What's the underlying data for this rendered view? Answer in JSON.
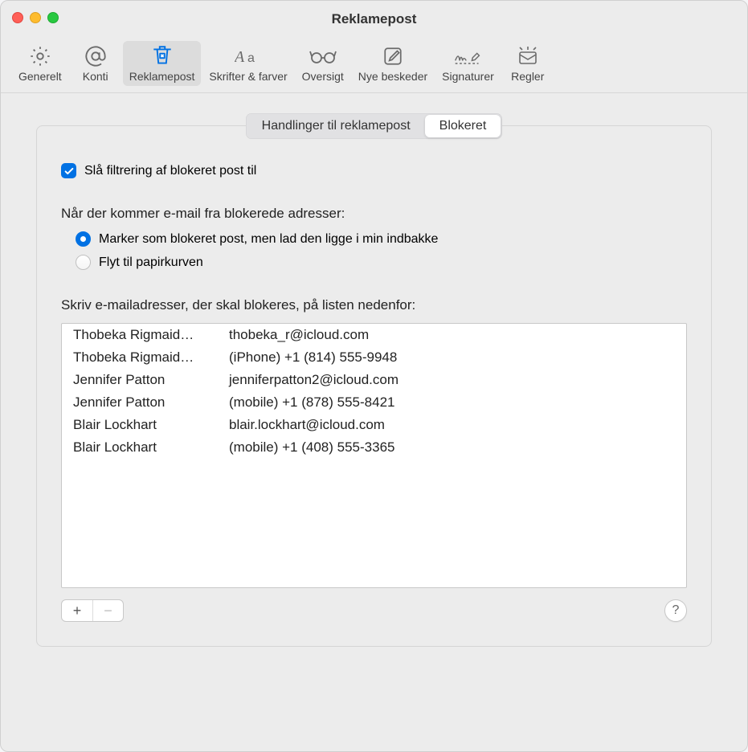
{
  "window": {
    "title": "Reklamepost"
  },
  "toolbar": [
    {
      "id": "general",
      "label": "Generelt",
      "icon": "gear",
      "selected": false
    },
    {
      "id": "accounts",
      "label": "Konti",
      "icon": "at",
      "selected": false
    },
    {
      "id": "junk",
      "label": "Reklamepost",
      "icon": "junk-bin",
      "selected": true
    },
    {
      "id": "fonts",
      "label": "Skrifter & farver",
      "icon": "fonts",
      "selected": false
    },
    {
      "id": "viewing",
      "label": "Oversigt",
      "icon": "glasses",
      "selected": false
    },
    {
      "id": "composing",
      "label": "Nye beskeder",
      "icon": "compose",
      "selected": false
    },
    {
      "id": "signatures",
      "label": "Signaturer",
      "icon": "signature",
      "selected": false
    },
    {
      "id": "rules",
      "label": "Regler",
      "icon": "rules",
      "selected": false
    }
  ],
  "segments": {
    "behaviors": "Handlinger til reklamepost",
    "blocked": "Blokeret",
    "active": "blocked"
  },
  "enable_label": "Slå filtrering af blokeret post til",
  "enable_checked": true,
  "when_label": "Når der kommer e-mail fra blokerede adresser:",
  "radio_options": [
    {
      "id": "mark",
      "label": "Marker som blokeret post, men lad den ligge i min indbakke",
      "checked": true
    },
    {
      "id": "trash",
      "label": "Flyt til papirkurven",
      "checked": false
    }
  ],
  "list_label": "Skriv e-mailadresser, der skal blokeres, på listen nedenfor:",
  "blocked_list": [
    {
      "name": "Thobeka Rigmaid…",
      "value": "thobeka_r@icloud.com"
    },
    {
      "name": "Thobeka Rigmaid…",
      "value": "(iPhone) +1 (814) 555-9948"
    },
    {
      "name": "Jennifer Patton",
      "value": "jenniferpatton2@icloud.com"
    },
    {
      "name": "Jennifer Patton",
      "value": "(mobile) +1 (878) 555-8421"
    },
    {
      "name": "Blair Lockhart",
      "value": "blair.lockhart@icloud.com"
    },
    {
      "name": "Blair Lockhart",
      "value": "(mobile) +1 (408) 555-3365"
    }
  ],
  "buttons": {
    "add": "+",
    "remove": "−",
    "help": "?"
  }
}
